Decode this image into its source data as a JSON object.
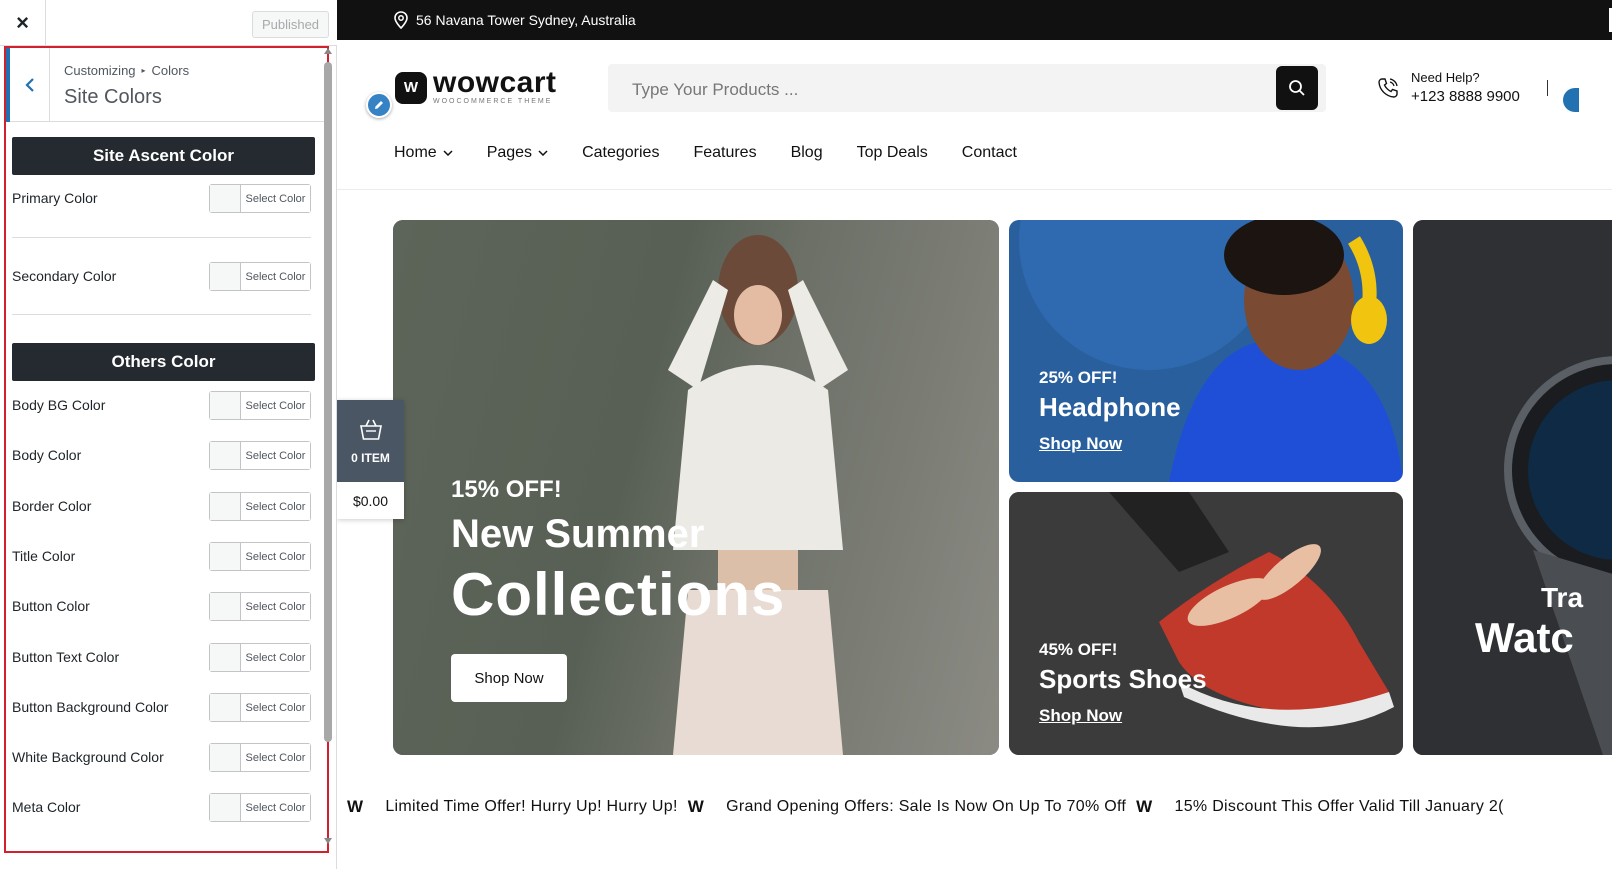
{
  "sidebar": {
    "close_label": "×",
    "published_label": "Published",
    "breadcrumb": {
      "root": "Customizing",
      "separator": "▸",
      "section": "Colors"
    },
    "panel_title": "Site Colors",
    "groups": [
      {
        "title": "Site Ascent Color"
      },
      {
        "title": "Others Color"
      }
    ],
    "select_color_label": "Select Color",
    "fields": [
      {
        "label": "Primary Color"
      },
      {
        "label": "Secondary Color"
      },
      {
        "label": "Body BG Color"
      },
      {
        "label": "Body Color"
      },
      {
        "label": "Border Color"
      },
      {
        "label": "Title Color"
      },
      {
        "label": "Button Color"
      },
      {
        "label": "Button Text Color"
      },
      {
        "label": "Button Background Color"
      },
      {
        "label": "White Background Color"
      },
      {
        "label": "Meta Color"
      }
    ]
  },
  "preview": {
    "topbar": {
      "address": "56 Navana Tower Sydney, Australia"
    },
    "logo": {
      "name": "wowcart",
      "tagline": "WOOCOMMERCE THEME",
      "badge": "W"
    },
    "search": {
      "placeholder": "Type Your Products ..."
    },
    "help": {
      "title": "Need Help?",
      "phone": "+123 8888 9900"
    },
    "nav": [
      {
        "label": "Home",
        "dropdown": true
      },
      {
        "label": "Pages",
        "dropdown": true
      },
      {
        "label": "Categories",
        "dropdown": false
      },
      {
        "label": "Features",
        "dropdown": false
      },
      {
        "label": "Blog",
        "dropdown": false
      },
      {
        "label": "Top Deals",
        "dropdown": false
      },
      {
        "label": "Contact",
        "dropdown": false
      }
    ],
    "hero": {
      "offer": "15% OFF!",
      "line1": "New Summer",
      "line2": "Collections",
      "button": "Shop Now"
    },
    "cards": [
      {
        "offer": "25% OFF!",
        "title": "Headphone",
        "link": "Shop Now"
      },
      {
        "offer": "45% OFF!",
        "title": "Sports Shoes",
        "link": "Shop Now"
      }
    ],
    "card3": {
      "line1": "Tra",
      "line2": "Watc"
    },
    "cart": {
      "items": "0 ITEM",
      "price": "$0.00"
    },
    "ticker": [
      "Limited Time Offer! Hurry Up! Hurry Up!",
      "Grand Opening Offers: Sale Is Now On Up To 70% Off",
      "15% Discount This Offer Valid Till January 2("
    ],
    "ticker_mark": "W"
  },
  "colors": {
    "accent_red_outline": "#d2202f",
    "dark_header": "#252a30",
    "wp_blue": "#2271b1"
  }
}
